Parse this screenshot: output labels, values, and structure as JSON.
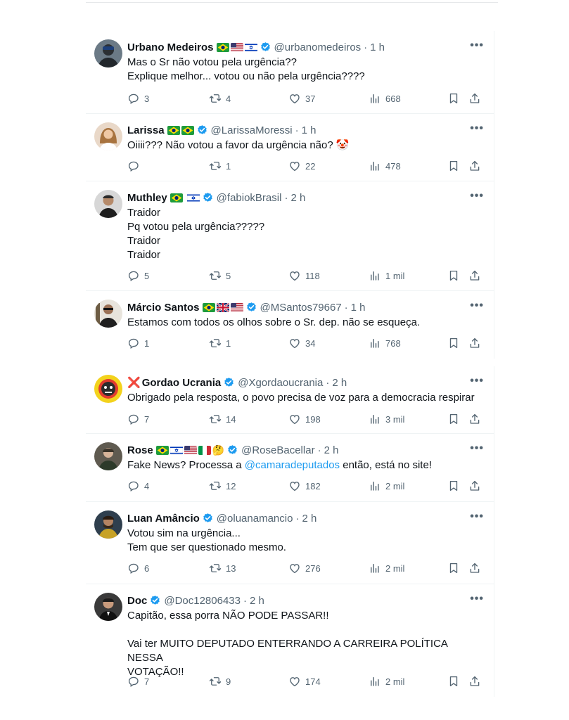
{
  "tweets": [
    {
      "name": "Urbano Medeiros",
      "handle": "@urbanomedeiros",
      "time": "1 h",
      "lines": [
        "Mas o Sr não votou pela urgência??",
        "Explique melhor... votou ou não pela urgência????"
      ],
      "replies": "3",
      "retweets": "4",
      "likes": "37",
      "views": "668"
    },
    {
      "name": "Larissa",
      "handle": "@LarissaMoressi",
      "time": "1 h",
      "lines": [
        "Oiiii??? Não votou a favor da urgência não? 🤡"
      ],
      "replies": "",
      "retweets": "1",
      "likes": "22",
      "views": "478"
    },
    {
      "name": "Muthley",
      "handle": "@fabiokBrasil",
      "time": "2 h",
      "lines": [
        "Traidor",
        "Pq votou pela urgência?????",
        "Traidor",
        "Traidor"
      ],
      "replies": "5",
      "retweets": "5",
      "likes": "118",
      "views": "1 mil"
    },
    {
      "name": "Márcio Santos",
      "handle": "@MSantos79667",
      "time": "1 h",
      "lines": [
        "Estamos com todos os olhos sobre o Sr. dep. não se esqueça."
      ],
      "replies": "1",
      "retweets": "1",
      "likes": "34",
      "views": "768"
    },
    {
      "name": "Gordao Ucrania",
      "name_prefix": "❌",
      "handle": "@Xgordaoucrania",
      "time": "2 h",
      "lines": [
        "Obrigado pela resposta, o povo precisa de voz para a democracia respirar"
      ],
      "replies": "7",
      "retweets": "14",
      "likes": "198",
      "views": "3 mil"
    },
    {
      "name": "Rose",
      "handle": "@RoseBacellar",
      "time": "2 h",
      "line_before": "Fake News? Processa a ",
      "mention": "@camaradeputados",
      "line_after": " então, está no site!",
      "replies": "4",
      "retweets": "12",
      "likes": "182",
      "views": "2 mil"
    },
    {
      "name": "Luan Amâncio",
      "handle": "@oluanamancio",
      "time": "2 h",
      "lines": [
        "Votou sim na urgência...",
        "Tem que ser questionado mesmo."
      ],
      "replies": "6",
      "retweets": "13",
      "likes": "276",
      "views": "2 mil"
    },
    {
      "name": "Doc",
      "handle": "@Doc12806433",
      "time": "2 h",
      "lines": [
        "Capitão, essa porra NÃO PODE PASSAR!!"
      ],
      "lines2": [
        "Vai ter MUITO DEPUTADO ENTERRANDO A CARREIRA POLÍTICA NESSA",
        "VOTAÇÃO!!"
      ],
      "replies": "7",
      "retweets": "9",
      "likes": "174",
      "views": "2 mil"
    }
  ],
  "ui": {
    "more": "•••",
    "dot": "·"
  },
  "icons": {
    "reply": "reply-icon",
    "retweet": "retweet-icon",
    "like": "heart-icon",
    "views": "views-icon",
    "bookmark": "bookmark-icon",
    "share": "share-icon",
    "verified": "verified-badge-icon",
    "more": "more-options-icon"
  },
  "colors": {
    "text": "#0f1419",
    "secondary": "#536471",
    "verified": "#1d9bf0",
    "mention": "#1d9bf0",
    "border": "#eff3f4"
  }
}
